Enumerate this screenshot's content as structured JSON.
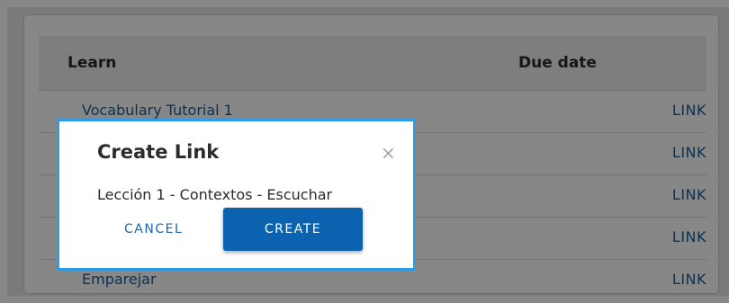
{
  "table": {
    "col_learn": "Learn",
    "col_due": "Due date",
    "rows": [
      {
        "name": "Vocabulary Tutorial 1",
        "link": "LINK"
      },
      {
        "name": "",
        "link": "LINK"
      },
      {
        "name": "",
        "link": "LINK"
      },
      {
        "name": "",
        "link": "LINK"
      },
      {
        "name": "Emparejar",
        "link": "LINK"
      }
    ]
  },
  "dialog": {
    "title": "Create Link",
    "close_icon": "×",
    "body": "Lección 1 - Contextos - Escuchar",
    "cancel_label": "CANCEL",
    "create_label": "CREATE"
  }
}
